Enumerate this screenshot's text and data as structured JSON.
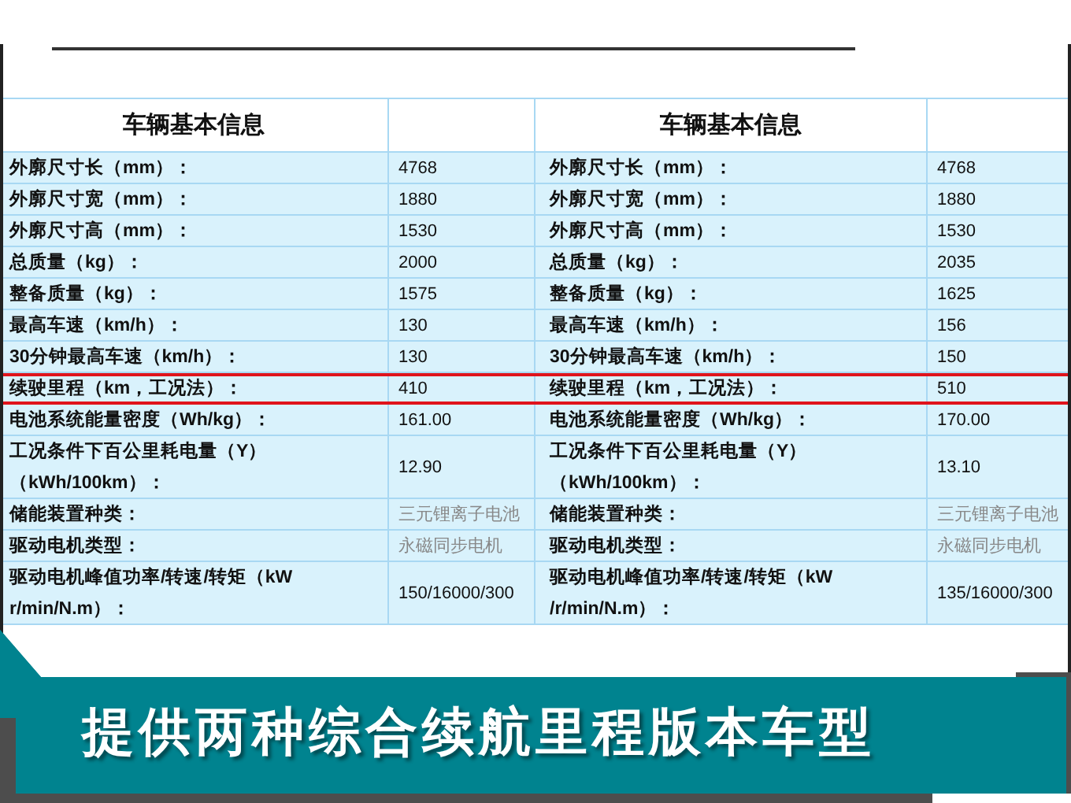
{
  "tables": [
    {
      "title": "车辆基本信息"
    },
    {
      "title": "车辆基本信息"
    }
  ],
  "rows": [
    {
      "highlighted": false,
      "left": {
        "label": [
          "外廓尺寸长（mm）："
        ],
        "value": "4768",
        "kind": "number"
      },
      "right": {
        "label": [
          "外廓尺寸长（mm）："
        ],
        "value": "4768",
        "kind": "number"
      }
    },
    {
      "highlighted": false,
      "left": {
        "label": [
          "外廓尺寸宽（mm）："
        ],
        "value": "1880",
        "kind": "number"
      },
      "right": {
        "label": [
          "外廓尺寸宽（mm）："
        ],
        "value": "1880",
        "kind": "number"
      }
    },
    {
      "highlighted": false,
      "left": {
        "label": [
          "外廓尺寸高（mm）："
        ],
        "value": "1530",
        "kind": "number"
      },
      "right": {
        "label": [
          "外廓尺寸高（mm）："
        ],
        "value": "1530",
        "kind": "number"
      }
    },
    {
      "highlighted": false,
      "left": {
        "label": [
          "总质量（kg）："
        ],
        "value": "2000",
        "kind": "number"
      },
      "right": {
        "label": [
          "总质量（kg）："
        ],
        "value": "2035",
        "kind": "number"
      }
    },
    {
      "highlighted": false,
      "left": {
        "label": [
          "整备质量（kg）："
        ],
        "value": "1575",
        "kind": "number"
      },
      "right": {
        "label": [
          "整备质量（kg）："
        ],
        "value": "1625",
        "kind": "number"
      }
    },
    {
      "highlighted": false,
      "left": {
        "label": [
          "最高车速（km/h）："
        ],
        "value": "130",
        "kind": "number"
      },
      "right": {
        "label": [
          "最高车速（km/h）："
        ],
        "value": "156",
        "kind": "number"
      }
    },
    {
      "highlighted": false,
      "left": {
        "label": [
          "30分钟最高车速（km/h）："
        ],
        "value": "130",
        "kind": "number"
      },
      "right": {
        "label": [
          "30分钟最高车速（km/h）："
        ],
        "value": "150",
        "kind": "number"
      }
    },
    {
      "highlighted": true,
      "left": {
        "label": [
          "续驶里程（km，工况法）："
        ],
        "value": "410",
        "kind": "number"
      },
      "right": {
        "label": [
          "续驶里程（km，工况法）："
        ],
        "value": "510",
        "kind": "number"
      }
    },
    {
      "highlighted": false,
      "left": {
        "label": [
          "电池系统能量密度（Wh/kg）："
        ],
        "value": "161.00",
        "kind": "number"
      },
      "right": {
        "label": [
          "电池系统能量密度（Wh/kg）："
        ],
        "value": "170.00",
        "kind": "number"
      }
    },
    {
      "highlighted": false,
      "left": {
        "label": [
          "工况条件下百公里耗电量（Y）",
          "（kWh/100km）："
        ],
        "value": "12.90",
        "kind": "number"
      },
      "right": {
        "label": [
          "工况条件下百公里耗电量（Y）",
          "（kWh/100km）："
        ],
        "value": "13.10",
        "kind": "number"
      }
    },
    {
      "highlighted": false,
      "left": {
        "label": [
          "储能装置种类："
        ],
        "value": "三元锂离子电池",
        "kind": "text"
      },
      "right": {
        "label": [
          "储能装置种类："
        ],
        "value": "三元锂离子电池",
        "kind": "text"
      }
    },
    {
      "highlighted": false,
      "left": {
        "label": [
          "驱动电机类型："
        ],
        "value": "永磁同步电机",
        "kind": "text"
      },
      "right": {
        "label": [
          "驱动电机类型："
        ],
        "value": "永磁同步电机",
        "kind": "text"
      }
    },
    {
      "highlighted": false,
      "left": {
        "label": [
          "驱动电机峰值功率/转速/转矩（kW",
          "r/min/N.m）："
        ],
        "value": "150/16000/300",
        "kind": "number"
      },
      "right": {
        "label": [
          "驱动电机峰值功率/转速/转矩（kW",
          "/r/min/N.m）："
        ],
        "value": "135/16000/300",
        "kind": "number"
      }
    }
  ],
  "caption": "提供两种综合续航里程版本车型"
}
